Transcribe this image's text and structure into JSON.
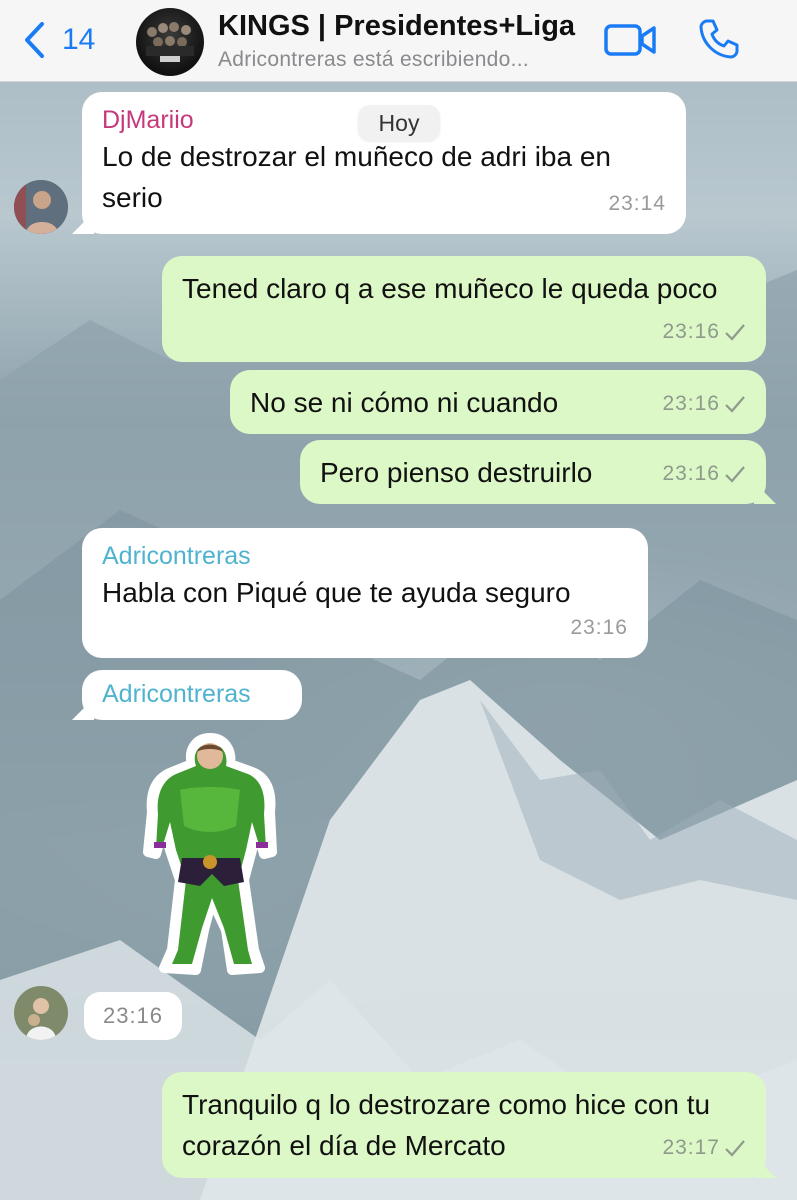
{
  "header": {
    "back_count": "14",
    "group_title": "KINGS | Presidentes+Liga",
    "typing_status": "Adricontreras está escribiendo...",
    "icons": {
      "back": "chevron-left-icon",
      "video": "video-camera-icon",
      "call": "phone-icon"
    },
    "accent_color": "#1a7cf5"
  },
  "date_separator": "Hoy",
  "messages": [
    {
      "direction": "in",
      "sender": "DjMariio",
      "sender_color": "#c5397a",
      "text": "Lo de destrozar el muñeco de adri iba en serio",
      "time": "23:14"
    },
    {
      "direction": "out",
      "text": "Tened claro q a ese muñeco le queda poco",
      "time": "23:16",
      "status": "sent"
    },
    {
      "direction": "out",
      "text": "No se ni cómo ni cuando",
      "time": "23:16",
      "status": "sent"
    },
    {
      "direction": "out",
      "text": "Pero pienso destruirlo",
      "time": "23:16",
      "status": "sent"
    },
    {
      "direction": "in",
      "sender": "Adricontreras",
      "sender_color": "#4fb3cf",
      "text": "Habla con Piqué que te ayuda seguro",
      "time": "23:16"
    },
    {
      "direction": "in",
      "sender": "Adricontreras",
      "sender_color": "#4fb3cf",
      "type": "sticker",
      "sticker": "green-muscle-figure-sticker",
      "time": "23:16"
    },
    {
      "direction": "out",
      "text": "Tranquilo q lo destrozare como hice con tu corazón el día de Mercato",
      "time": "23:17",
      "status": "sent"
    }
  ],
  "colors": {
    "incoming_bubble": "#ffffff",
    "outgoing_bubble": "#dcf8c6"
  }
}
